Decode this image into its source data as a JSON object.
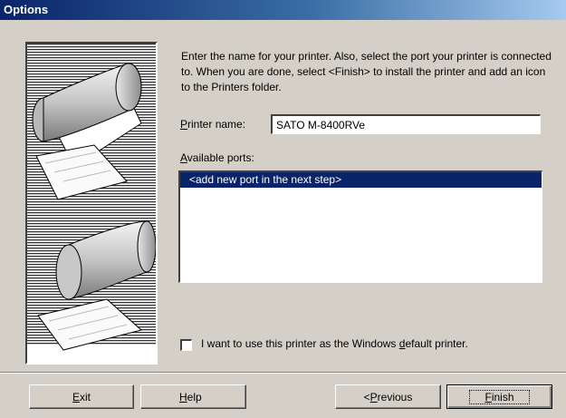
{
  "title": "Options",
  "intro": "Enter the name for your printer. Also, select the port your printer is connected to. When you are done, select <Finish> to install the printer and add an icon to the Printers folder.",
  "printer_name": {
    "mnemonic": "P",
    "label_rest": "rinter name:",
    "value": "SATO M-8400RVe"
  },
  "ports": {
    "mnemonic": "A",
    "label_rest": "vailable ports:",
    "items": [
      "<add new port in the next step>"
    ]
  },
  "default_checkbox": {
    "before": "I want to use this printer as the Windows ",
    "mnemonic": "d",
    "after": "efault printer.",
    "checked": false
  },
  "buttons": {
    "exit": {
      "mnemonic": "E",
      "rest": "xit"
    },
    "help": {
      "mnemonic": "H",
      "rest": "elp"
    },
    "previous": {
      "prefix": "< ",
      "mnemonic": "P",
      "rest": "revious"
    },
    "finish": {
      "mnemonic": "F",
      "rest": "inish"
    }
  },
  "colors": {
    "titlebar_start": "#0a246a",
    "titlebar_end": "#a6caf0",
    "face": "#d4d0c8",
    "selection": "#0a246a"
  }
}
